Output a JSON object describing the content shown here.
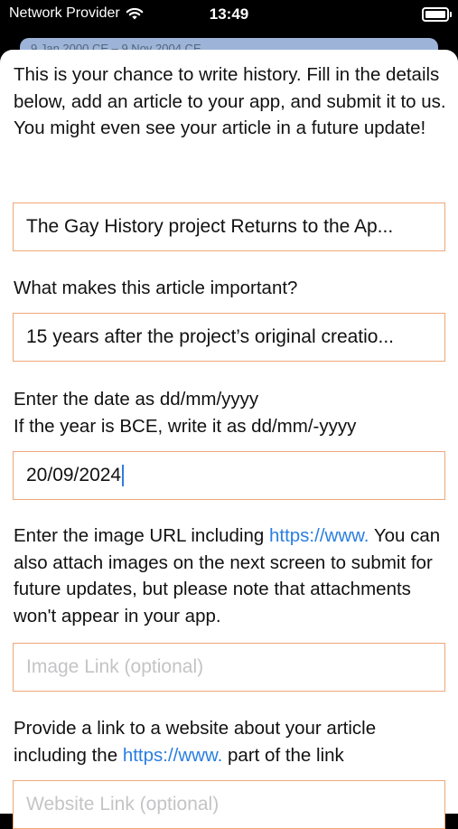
{
  "status_bar": {
    "carrier": "Network Provider",
    "time": "13:49"
  },
  "background_card": {
    "text": "9 Jan 2000 CE – 9 Nov 2004 CE"
  },
  "intro_text": "This is your chance to write history. Fill in the details below, add an article to your app, and submit it to us. You might even see your article in a future update!",
  "title_field": {
    "value": "The Gay History project Returns to the Ap..."
  },
  "importance": {
    "label": "What makes this article important?",
    "value": "15 years after the project’s original creatio..."
  },
  "date": {
    "label_line1": "Enter the date as dd/mm/yyyy",
    "label_line2": "If the year is BCE, write it as dd/mm/-yyyy",
    "value": "20/09/2024"
  },
  "image": {
    "label_pre": "Enter the image URL including ",
    "label_link": "https://www.",
    "label_post": " You can also attach images on the next screen to submit for future updates, but please note that attachments won't appear in your app.",
    "placeholder": "Image Link (optional)"
  },
  "website": {
    "label_pre": "Provide a link to a website about your article including the ",
    "label_link": "https://www.",
    "label_post": " part of the link",
    "placeholder": "Website Link (optional)"
  },
  "colors": {
    "accent": "#2a7ee0",
    "field_border": "#f0a778",
    "placeholder": "#c4c4c6"
  }
}
